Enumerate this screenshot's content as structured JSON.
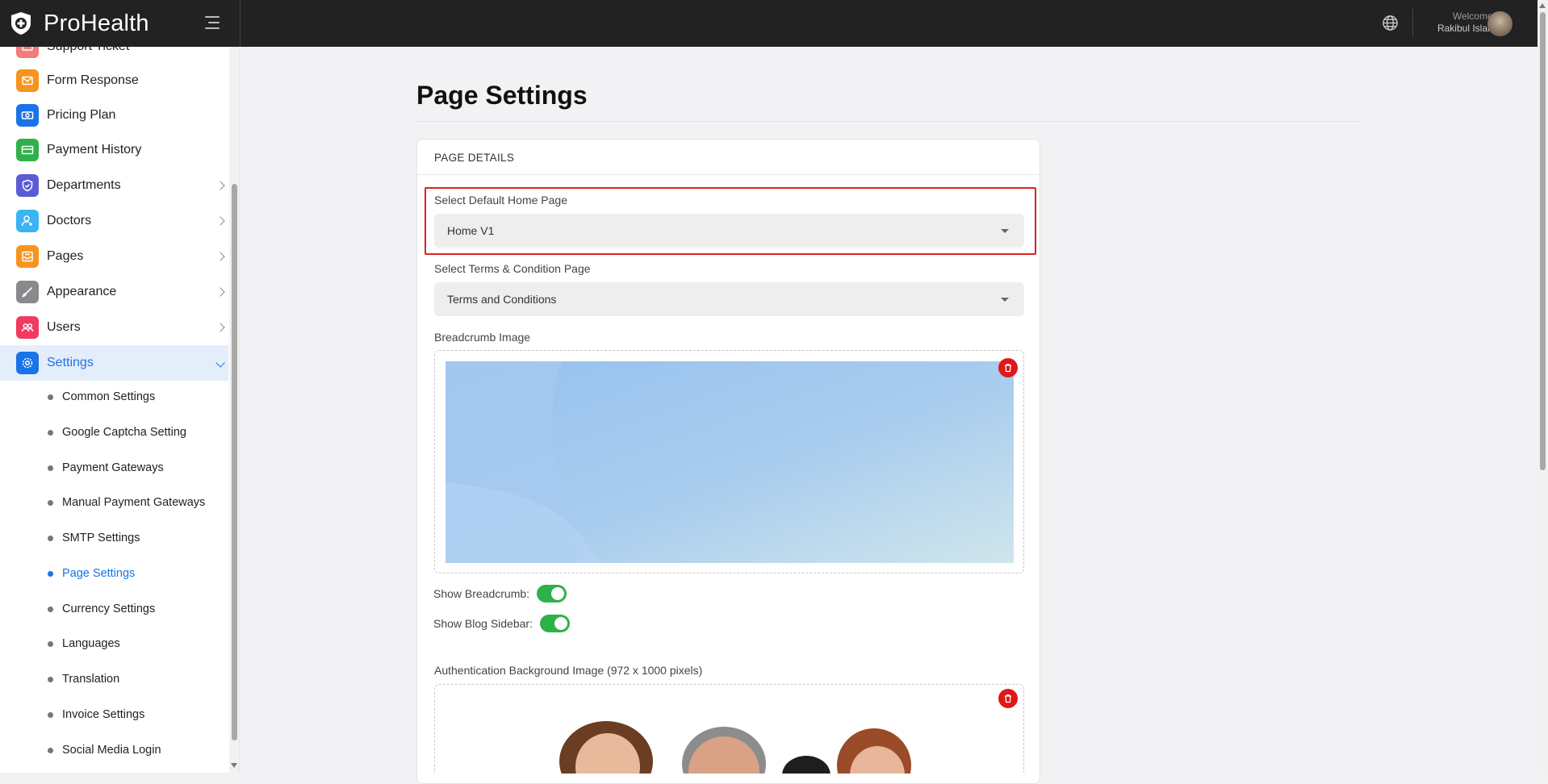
{
  "brand": {
    "name": "ProHealth"
  },
  "header": {
    "welcome_label": "Welcome,",
    "user_name": "Rakibul Islam"
  },
  "sidebar": {
    "items": [
      {
        "label": "Support Ticket",
        "icon": "ticket-icon",
        "color": "#f27b7b"
      },
      {
        "label": "Form Response",
        "icon": "mail-icon",
        "color": "#f7941d"
      },
      {
        "label": "Pricing Plan",
        "icon": "money-icon",
        "color": "#1a73e8"
      },
      {
        "label": "Payment History",
        "icon": "card-icon",
        "color": "#2fb14a"
      },
      {
        "label": "Departments",
        "icon": "shield-icon",
        "color": "#5b5bd6"
      },
      {
        "label": "Doctors",
        "icon": "user-add-icon",
        "color": "#3ab4f2"
      },
      {
        "label": "Pages",
        "icon": "inbox-icon",
        "color": "#f7941d"
      },
      {
        "label": "Appearance",
        "icon": "brush-icon",
        "color": "#8a8a8e"
      },
      {
        "label": "Users",
        "icon": "users-icon",
        "color": "#f2395f"
      },
      {
        "label": "Settings",
        "icon": "gear-icon",
        "color": "#1a73e8"
      }
    ],
    "settings_sub": [
      "Common Settings",
      "Google Captcha Setting",
      "Payment Gateways",
      "Manual Payment Gateways",
      "SMTP Settings",
      "Page Settings",
      "Currency Settings",
      "Languages",
      "Translation",
      "Invoice Settings",
      "Social Media Login"
    ]
  },
  "main": {
    "title": "Page Settings",
    "card_header": "PAGE DETAILS",
    "home_page": {
      "label": "Select Default Home Page",
      "value": "Home V1"
    },
    "terms_page": {
      "label": "Select Terms & Condition Page",
      "value": "Terms and Conditions"
    },
    "breadcrumb_image_label": "Breadcrumb Image",
    "show_breadcrumb": {
      "label": "Show Breadcrumb:",
      "on": true
    },
    "show_blog_sidebar": {
      "label": "Show Blog Sidebar:",
      "on": true
    },
    "auth_bg_label": "Authentication Background Image (972 x 1000 pixels)"
  },
  "colors": {
    "accent": "#1a73e8",
    "toggle_on": "#2fb14a",
    "delete": "#e01818",
    "highlight": "#e02020"
  }
}
